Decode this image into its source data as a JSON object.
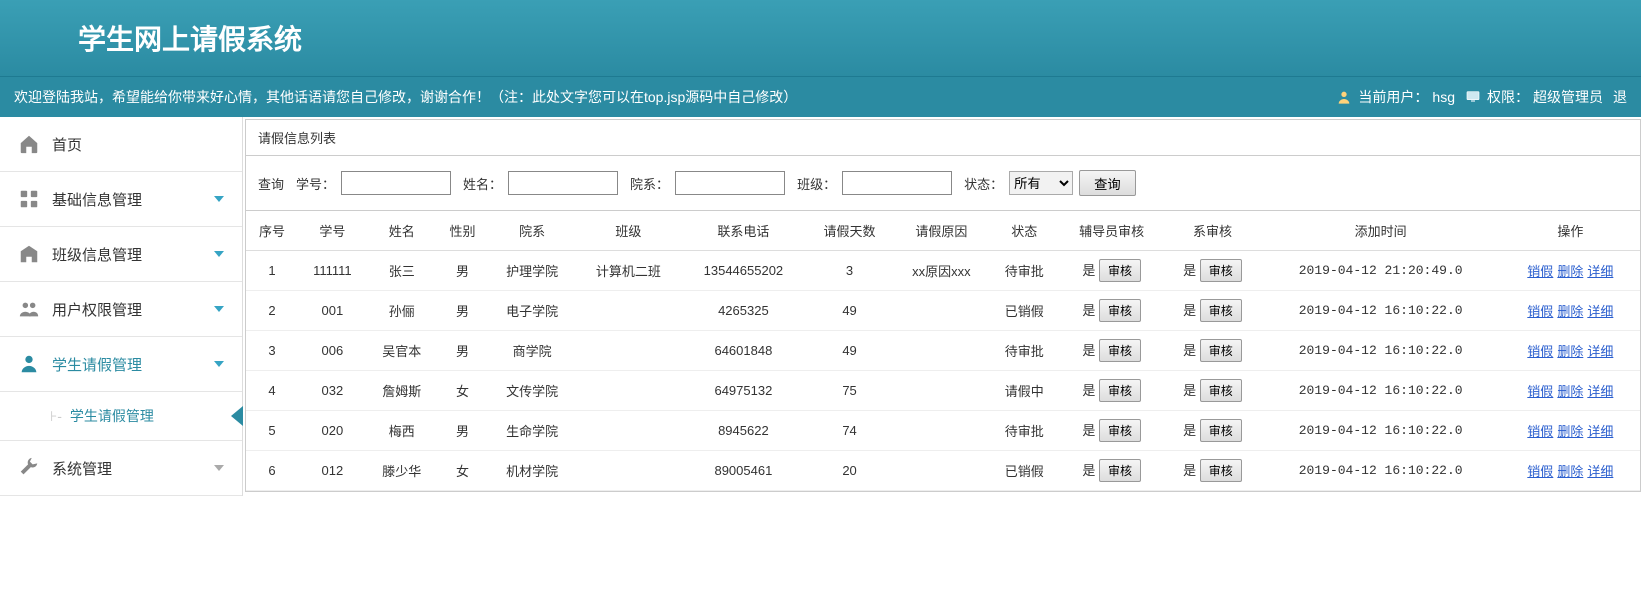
{
  "header": {
    "title": "学生网上请假系统",
    "welcome": "欢迎登陆我站，希望能给你带来好心情，其他话语请您自己修改，谢谢合作！（注：此处文字您可以在top.jsp源码中自己修改）",
    "user_label": "当前用户：",
    "user_value": "hsg",
    "role_label": "权限：",
    "role_value": "超级管理员",
    "logout": "退"
  },
  "sidebar": {
    "home": "首页",
    "base": "基础信息管理",
    "class": "班级信息管理",
    "user": "用户权限管理",
    "leave": "学生请假管理",
    "leave_sub": "学生请假管理",
    "system": "系统管理"
  },
  "panel": {
    "title": "请假信息列表",
    "search_prefix": "查询",
    "id_label": "学号：",
    "name_label": "姓名：",
    "dept_label": "院系：",
    "class_label": "班级：",
    "status_label": "状态：",
    "status_value": "所有",
    "search_btn": "查询"
  },
  "columns": {
    "seq": "序号",
    "id": "学号",
    "name": "姓名",
    "gender": "性别",
    "dept": "院系",
    "class": "班级",
    "phone": "联系电话",
    "days": "请假天数",
    "reason": "请假原因",
    "status": "状态",
    "advisor": "辅导员审核",
    "dept_review": "系审核",
    "addtime": "添加时间",
    "op": "操作"
  },
  "review_yes": "是",
  "review_btn": "审核",
  "op_cancel": "销假",
  "op_delete": "删除",
  "op_detail": "详细",
  "rows": [
    {
      "seq": "1",
      "id": "111111",
      "name": "张三",
      "gender": "男",
      "dept": "护理学院",
      "class": "计算机二班",
      "phone": "13544655202",
      "days": "3",
      "reason": "xx原因xxx",
      "status": "待审批",
      "addtime": "2019-04-12 21:20:49.0"
    },
    {
      "seq": "2",
      "id": "001",
      "name": "孙俪",
      "gender": "男",
      "dept": "电子学院",
      "class": "",
      "phone": "4265325",
      "days": "49",
      "reason": "",
      "status": "已销假",
      "addtime": "2019-04-12 16:10:22.0"
    },
    {
      "seq": "3",
      "id": "006",
      "name": "吴官本",
      "gender": "男",
      "dept": "商学院",
      "class": "",
      "phone": "64601848",
      "days": "49",
      "reason": "",
      "status": "待审批",
      "addtime": "2019-04-12 16:10:22.0"
    },
    {
      "seq": "4",
      "id": "032",
      "name": "詹姆斯",
      "gender": "女",
      "dept": "文传学院",
      "class": "",
      "phone": "64975132",
      "days": "75",
      "reason": "",
      "status": "请假中",
      "addtime": "2019-04-12 16:10:22.0"
    },
    {
      "seq": "5",
      "id": "020",
      "name": "梅西",
      "gender": "男",
      "dept": "生命学院",
      "class": "",
      "phone": "8945622",
      "days": "74",
      "reason": "",
      "status": "待审批",
      "addtime": "2019-04-12 16:10:22.0"
    },
    {
      "seq": "6",
      "id": "012",
      "name": "滕少华",
      "gender": "女",
      "dept": "机材学院",
      "class": "",
      "phone": "89005461",
      "days": "20",
      "reason": "",
      "status": "已销假",
      "addtime": "2019-04-12 16:10:22.0"
    }
  ]
}
